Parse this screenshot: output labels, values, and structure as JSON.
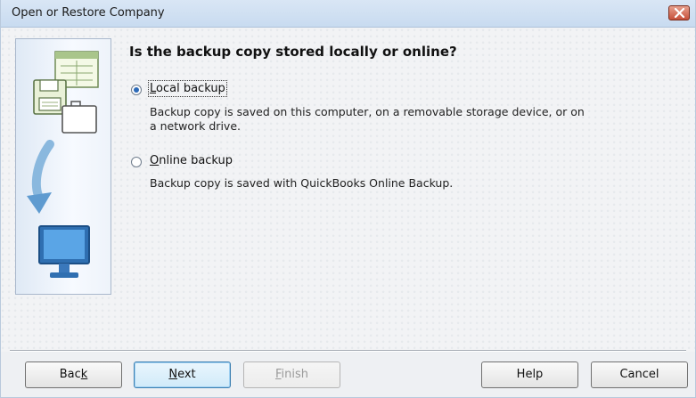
{
  "window": {
    "title": "Open or Restore Company"
  },
  "main": {
    "question": "Is the backup copy stored locally or online?",
    "options": [
      {
        "label_pre": "",
        "label_accel": "L",
        "label_post": "ocal backup",
        "selected": true,
        "description_line1": "Backup copy is saved on this computer, on a removable storage device, or on",
        "description_line2": "a network drive."
      },
      {
        "label_pre": "",
        "label_accel": "O",
        "label_post": "nline backup",
        "selected": false,
        "description_line1": "Backup copy is saved with QuickBooks Online Backup."
      }
    ]
  },
  "buttons": {
    "back": {
      "pre": "Bac",
      "accel": "k",
      "post": ""
    },
    "next": {
      "pre": "",
      "accel": "N",
      "post": "ext"
    },
    "finish": {
      "pre": "",
      "accel": "F",
      "post": "inish"
    },
    "help": "Help",
    "cancel": "Cancel"
  },
  "icons": {
    "side_panel": [
      "document-icon",
      "floppy-disk-icon",
      "briefcase-icon",
      "arrow-down-icon",
      "monitor-icon"
    ],
    "close": "close-icon"
  },
  "colors": {
    "titlebar": "#c8dbf0",
    "accent": "#2d6ab8",
    "close_button": "#c6503a"
  }
}
